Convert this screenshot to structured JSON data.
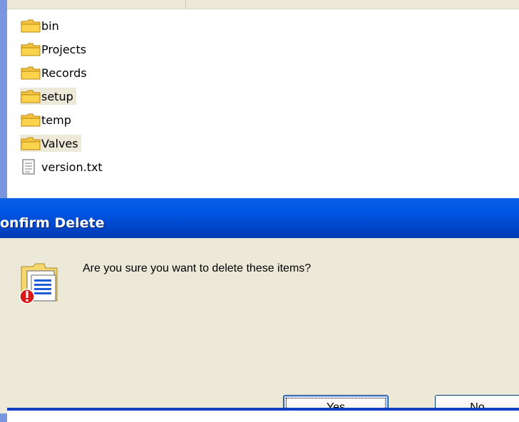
{
  "files": [
    {
      "name": "bin",
      "type": "folder",
      "icon": "folder-icon",
      "selected": false
    },
    {
      "name": "Projects",
      "type": "folder",
      "icon": "folder-icon",
      "selected": false
    },
    {
      "name": "Records",
      "type": "folder",
      "icon": "folder-icon",
      "selected": false
    },
    {
      "name": "setup",
      "type": "folder",
      "icon": "folder-icon",
      "selected": true
    },
    {
      "name": "temp",
      "type": "folder",
      "icon": "folder-icon",
      "selected": false
    },
    {
      "name": "Valves",
      "type": "folder",
      "icon": "folder-icon",
      "selected": true
    },
    {
      "name": "version.txt",
      "type": "file",
      "icon": "text-file-icon",
      "selected": false
    }
  ],
  "dialog": {
    "title": "onfirm Delete",
    "message": "Are you sure you want to delete these items?",
    "icon": "delete-warning-icon",
    "yes_label": "Yes",
    "no_label": "No"
  },
  "colors": {
    "titlebar": "#0054e3",
    "dialog_bg": "#ece9d8",
    "selection": "#ece9d8"
  }
}
